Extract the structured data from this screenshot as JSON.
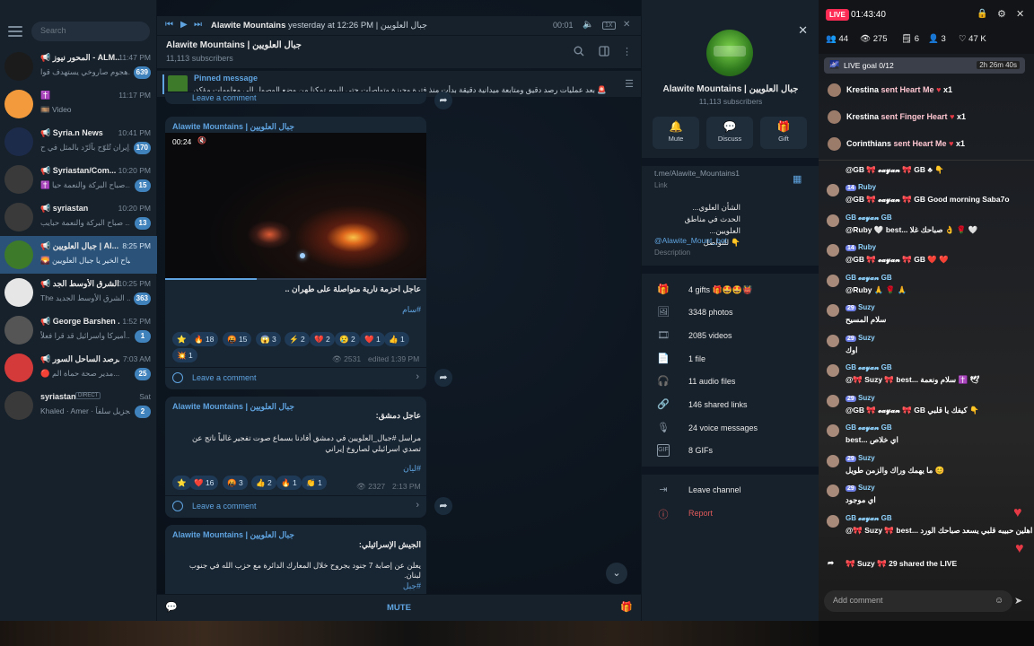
{
  "sidebar": {
    "search_placeholder": "Search",
    "chats": [
      {
        "name": "📢 المحور نيوز - ALM...",
        "time": "11:47 PM",
        "preview": "هجوم صاروخي يستهدف قوا...",
        "badge": "639",
        "avatar_color": "#1b1b1b"
      },
      {
        "name": "✝️",
        "time": "11:17 PM",
        "preview": "🎞️ Video",
        "badge": "",
        "avatar_color": "#f29a3c"
      },
      {
        "name": "📢 Syria.n News",
        "time": "10:41 PM",
        "preview": "إيران تُلوّح بآلرّد بالمثل في ح...",
        "badge": "170",
        "avatar_color": "#1d2b4a"
      },
      {
        "name": "📢 Syriastan/Com...",
        "time": "10:20 PM",
        "preview": "✝️ صباح البركة والنعمة حيا...",
        "badge": "15",
        "avatar_color": "#3a3a3a"
      },
      {
        "name": "📢 syriastan",
        "time": "10:20 PM",
        "preview": "صباح البركة والنعمة حبايب ...",
        "badge": "13",
        "avatar_color": "#3a3a3a"
      },
      {
        "name": "📢 جبال العلويين | Al...",
        "time": "8:25 PM",
        "preview": "🌄 صباح الخير يا جبال العلويين......",
        "badge": "",
        "avatar_color": "#3d7a2a"
      },
      {
        "name": "📢 الشرق الأوسط الجد...",
        "time": "10:25 PM",
        "preview": "The الشرق الأوسط الجديد ...",
        "badge": "363",
        "avatar_color": "#e6e6e6"
      },
      {
        "name": "📢 George Barshen ...",
        "time": "1:52 PM",
        "preview": "أميركا واسرائيل قد قرا فعلاً...",
        "badge": "1",
        "avatar_color": "#555"
      },
      {
        "name": "📢 مرصد الساحل السور...",
        "time": "7:03 AM",
        "preview": "🔴 مدير صحة حماة الم...",
        "badge": "25",
        "avatar_color": "#d43a3a"
      },
      {
        "name": "syriastan",
        "time": "Sat",
        "preview": "Khaled · Amer · الشكر الجزيل سلفاً",
        "badge": "2",
        "avatar_color": "#3a3a3a",
        "tag": "DIRECT"
      }
    ]
  },
  "player": {
    "title": "Alawite Mountains",
    "subtitle": "yesterday at 12:26 PM | جبال العلويين",
    "time": "00:01",
    "speed": "1X"
  },
  "channel": {
    "name": "Alawite Mountains | جبال العلويين",
    "subscribers": "11,113 subscribers"
  },
  "pinned": {
    "label": "Pinned message",
    "text": "🚨 بعد عمليات رصد دقيق ومتابعة ميدانية دقيقة بدأت منذ فترة وجيزة وتواصلت حتى اليوم تمكنا من وضع الوصول الى معلومات مؤكدة ..."
  },
  "messages": [
    {
      "sender": "Alawite Mountains | جبال العلويين",
      "video_time": "00:24",
      "text": "عاجل احزمة نارية متواصلة على طهران ..",
      "hashtag": "#سام",
      "reactions": [
        "⭐",
        "🔥 18",
        "🤬 15",
        "😱 3",
        "⚡ 2",
        "💔 2",
        "😢 2",
        "❤️ 1",
        "👍 1",
        "💥 1"
      ],
      "views": "2531",
      "time": "edited 1:39 PM",
      "comment": "Leave a comment"
    },
    {
      "sender": "Alawite Mountains | جبال العلويين",
      "text_title": "عاجل دمشق:",
      "text": "مراسل #جبال_العلويين في دمشق أفادنا بسماع صوت تفجير غالباً ناتج عن تصدي اسرائيلي لصاروخ إيراني",
      "hashtag": "#ليان",
      "reactions": [
        "⭐",
        "❤️ 16",
        "🤬 3",
        "👍 2",
        "🔥 1",
        "👏 1"
      ],
      "views": "2327",
      "time": "2:13 PM",
      "comment": "Leave a comment"
    },
    {
      "sender": "Alawite Mountains | جبال العلويين",
      "text_title": "الجيش الإسرائيلي:",
      "text": "يعلن عن إصابة 7 جنود بجروح خلال المعارك الدائرة مع حزب الله في جنوب لبنان.",
      "hashtag": "#جبل"
    }
  ],
  "top_partial_comment": "Leave a comment",
  "composer": {
    "mute_label": "MUTE"
  },
  "profile": {
    "name": "Alawite Mountains | جبال العلويين",
    "subscribers": "11,113 subscribers",
    "buttons": [
      {
        "icon": "bell-icon",
        "label": "Mute"
      },
      {
        "icon": "chat-icon",
        "label": "Discuss"
      },
      {
        "icon": "gift-icon",
        "label": "Gift"
      }
    ],
    "link": "t.me/Alawite_Mountains1",
    "link_label": "Link",
    "description_lines": [
      "الشأن العلوي...",
      "الحدث في مناطق العلويين...",
      "👇 للتواصل"
    ],
    "bot": "@Alawite_Mount_bot",
    "description_label": "Description",
    "media": [
      {
        "icon": "gift-icon",
        "label": "4 gifts 🎁🤩🤩👹"
      },
      {
        "icon": "photo-icon",
        "label": "3348 photos"
      },
      {
        "icon": "video-icon",
        "label": "2085 videos"
      },
      {
        "icon": "file-icon",
        "label": "1 file"
      },
      {
        "icon": "headphones-icon",
        "label": "11 audio files"
      },
      {
        "icon": "link-icon",
        "label": "146 shared links"
      },
      {
        "icon": "mic-icon",
        "label": "24 voice messages"
      },
      {
        "icon": "gif-icon",
        "label": "8 GIFs"
      }
    ],
    "leave": "Leave channel",
    "report": "Report"
  },
  "live": {
    "badge": "LIVE",
    "elapsed": "01:43:40",
    "stats": [
      "👥 44",
      "👁 275",
      "🗒 6",
      "👤 3",
      "♡ 47 K"
    ],
    "goal_label": "LIVE goal 0/12",
    "goal_time": "2h 26m 40s",
    "gifts": [
      {
        "user": "Krestina",
        "action": "sent Heart Me",
        "count": "x1"
      },
      {
        "user": "Krestina",
        "action": "sent Finger Heart",
        "count": "x1"
      },
      {
        "user": "Corinthians",
        "action": "sent Heart Me",
        "count": "x1"
      }
    ],
    "comments": [
      {
        "user": "𝓮𝓪𝔂𝓪𝓷",
        "level": "",
        "text": "@GB 🎀 𝓮𝓪𝔂𝓪𝓷 🎀 GB ♣ 👇"
      },
      {
        "user": "Ruby",
        "level": "14",
        "text": "@GB 🎀 𝓮𝓪𝔂𝓪𝓷 🎀 GB Good morning Saba7o"
      },
      {
        "user": "GB 𝓮𝓪𝔂𝓪𝓷 GB",
        "level": "",
        "text": "@Ruby 🤍 best... صباحك غلا 👌 🌹 🤍"
      },
      {
        "user": "Ruby",
        "level": "14",
        "text": "@GB 🎀 𝓮𝓪𝔂𝓪𝓷 🎀 GB ❤️ ❤️"
      },
      {
        "user": "GB 𝓮𝓪𝔂𝓪𝓷 GB",
        "level": "",
        "text": "@Ruby 🙏 🌹 🙏"
      },
      {
        "user": "Suzy",
        "level": "29",
        "text": "سلام المسيح"
      },
      {
        "user": "Suzy",
        "level": "29",
        "text": "اوك"
      },
      {
        "user": "GB 𝓮𝓪𝔂𝓪𝓷 GB",
        "level": "",
        "text": "@🎀 Suzy 🎀 best... سلام ونعمة ✝️ 🕊"
      },
      {
        "user": "Suzy",
        "level": "29",
        "text": "@GB 🎀 𝓮𝓪𝔂𝓪𝓷 🎀 GB كيفك يا قلبي 👇"
      },
      {
        "user": "GB 𝓮𝓪𝔂𝓪𝓷 GB",
        "level": "",
        "text": "best... اي خلاص"
      },
      {
        "user": "Suzy",
        "level": "29",
        "text": "ما يهمك وراك والزمن طويل 😊"
      },
      {
        "user": "Suzy",
        "level": "29",
        "text": "اي موجود"
      },
      {
        "user": "GB 𝓮𝓪𝔂𝓪𝓷 GB",
        "level": "",
        "text": "@🎀 Suzy 🎀 best... اهلين حبيبه قلبي يسعد صباحك الورد 🌹 👌"
      }
    ],
    "shared": "🎀 Suzy 🎀 29 shared the LIVE",
    "add_comment": "Add comment"
  }
}
